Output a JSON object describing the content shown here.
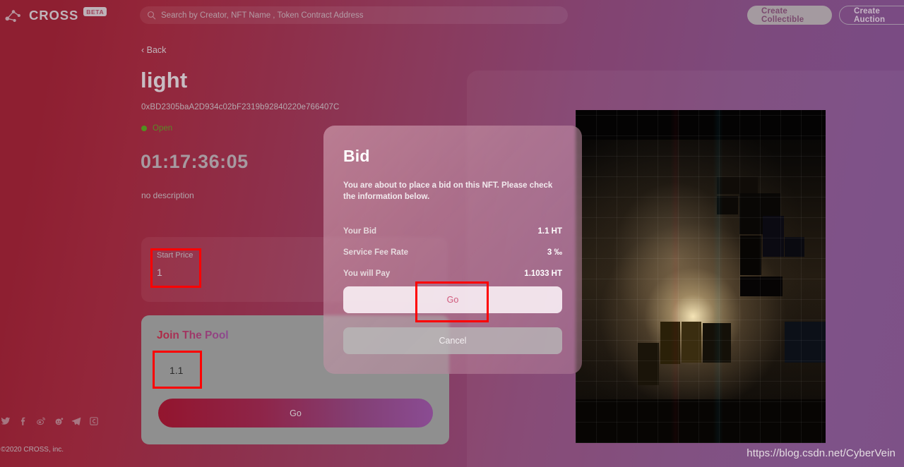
{
  "header": {
    "brand_name": "CROSS",
    "beta_badge": "BETA",
    "logo_icon": "network-nodes-icon",
    "search": {
      "placeholder": "Search by Creator, NFT Name , Token Contract Address",
      "value": "",
      "icon": "search-icon"
    },
    "buttons": {
      "create_collectible": "Create Collectible",
      "create_auction": "Create Auction"
    }
  },
  "detail": {
    "back_label": "‹ Back",
    "title": "light",
    "contract_address": "0xBD2305baA2D934c02bF2319b92840220e766407C",
    "status": "Open",
    "status_color": "#598a26",
    "countdown": "01:17:36:05",
    "description": "no description",
    "start_price": {
      "label": "Start Price",
      "value": "1"
    },
    "pool": {
      "title": "Join The Pool",
      "amount_value": "1.1",
      "amount_placeholder": "",
      "go_label": "Go"
    }
  },
  "modal": {
    "title": "Bid",
    "description": "You are about to place a bid on this NFT. Please check the information below.",
    "rows": [
      {
        "key": "Your Bid",
        "value": "1.1 HT"
      },
      {
        "key": "Service Fee Rate",
        "value": "3 ‰"
      },
      {
        "key": "You will Pay",
        "value": "1.1033 HT"
      }
    ],
    "confirm_label": "Go",
    "cancel_label": "Cancel"
  },
  "footer": {
    "social": [
      "twitter-icon",
      "facebook-icon",
      "weibo-icon",
      "reddit-icon",
      "telegram-icon",
      "coinmarket-icon"
    ],
    "copyright": "©2020 CROSS, inc."
  },
  "watermark": "https://blog.csdn.net/CyberVein",
  "annotations": {
    "start_price_box": "start-price-input",
    "pool_amount_box": "pool-amount-input",
    "modal_go_box": "modal-confirm-button"
  },
  "theme": {
    "bg_left": "#8e1f31",
    "bg_right": "#784a82",
    "accent_pink": "#d05a7c",
    "annotation_red": "#ff0000",
    "status_green": "#598a26"
  }
}
